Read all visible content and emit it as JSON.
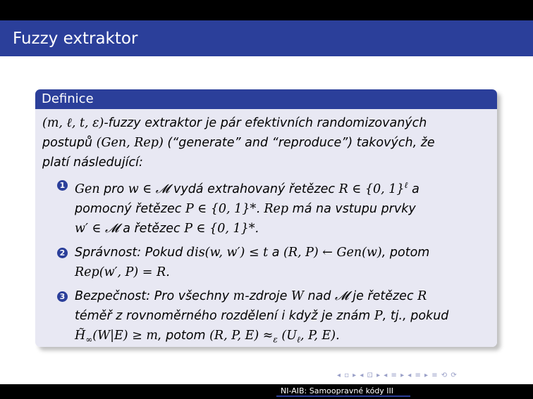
{
  "slide": {
    "title": "Fuzzy extraktor",
    "footer": "NI-AIB: Samoopravné kódy III",
    "nav_symbols": "◂ ▫ ▸ ◂ ⊡ ▸ ◂ ≡ ▸ ◂ ≡ ▸   ≡   ⟲ ⟳"
  },
  "block": {
    "heading": "Definice",
    "intro": {
      "params": "(m, ℓ, t, ε)",
      "t1": "-fuzzy extraktor je pár efektivních randomizovaných",
      "t2": "postupů ",
      "proc": "(Gen, Rep)",
      "t3": " (“generate” and “reproduce”) takových, že",
      "t4": "platí následující:"
    },
    "items": [
      {
        "num": "1",
        "a1": "Gen",
        "a2": " pro ",
        "a3": "w ∈ 𝓜",
        "a4": " vydá extrahovaný řetězec ",
        "a5": "R ∈ {0, 1}",
        "a5sup": "ℓ",
        "a6": " a",
        "b1": "pomocný řetězec ",
        "b2": "P ∈ {0, 1}*.",
        "b3": " ",
        "b4": "Rep",
        "b5": " má na vstupu prvky",
        "c1": "w′ ∈ 𝓜",
        "c2": " a řetězec ",
        "c3": "P ∈ {0, 1}*."
      },
      {
        "num": "2",
        "a1": "Správnost: Pokud ",
        "a2": "dis(w, w′) ≤ t",
        "a3": " a ",
        "a4": "(R, P) ← Gen(w)",
        "a5": ", potom",
        "b1": "Rep(w′, P) = R."
      },
      {
        "num": "3",
        "a1": "Bezpečnost: Pro všechny ",
        "a2": "m",
        "a3": "-zdroje ",
        "a4": "W",
        "a5": " nad ",
        "a6": "𝓜",
        "a7": " je řetězec ",
        "a8": "R",
        "b1": "téměř z rovnoměrného rozdělení i když je znám ",
        "b2": "P",
        "b3": ", tj., pokud",
        "c1": "H̃",
        "c1sub": "∞",
        "c2": "(W|E) ≥ m",
        "c3": ", potom ",
        "c4": "(R, P, E) ≈",
        "c4sub": "ε",
        "c5": " (U",
        "c5sub": "ℓ",
        "c6": ", P, E).",
        "c7": ""
      }
    ]
  }
}
